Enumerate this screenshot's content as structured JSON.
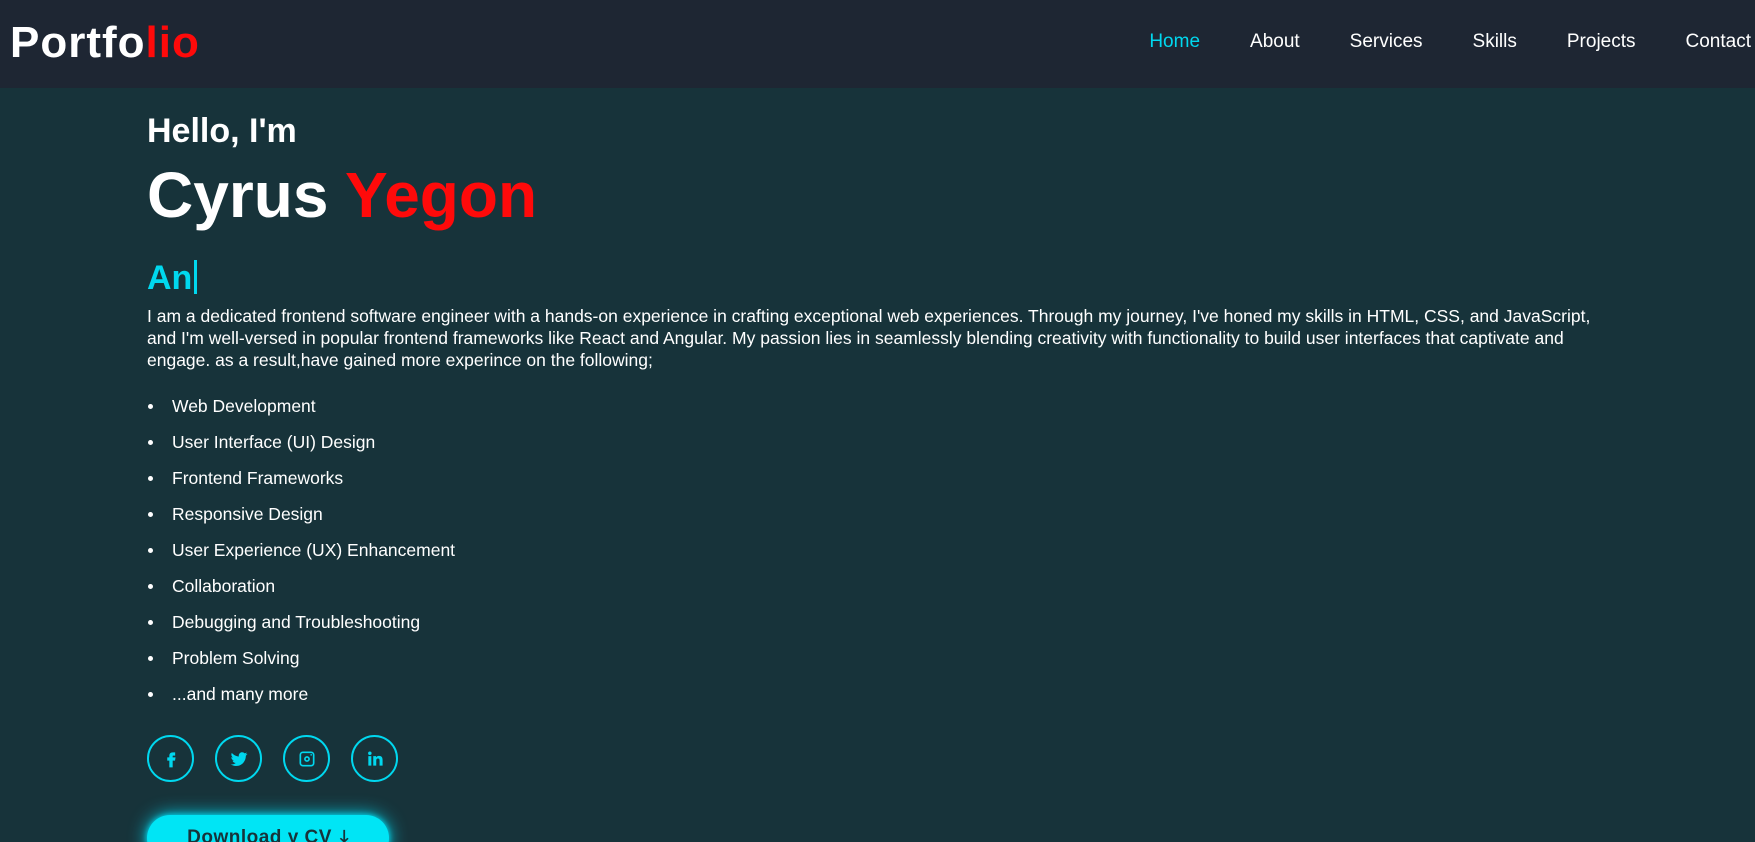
{
  "header": {
    "logo_part1": "Portfo",
    "logo_part2": "lio",
    "nav": [
      {
        "label": "Home",
        "active": true
      },
      {
        "label": "About"
      },
      {
        "label": "Services"
      },
      {
        "label": "Skills"
      },
      {
        "label": "Projects"
      },
      {
        "label": "Contact"
      }
    ]
  },
  "hero": {
    "greeting": "Hello, I'm",
    "first_name": "Cyrus",
    "last_name": "Yegon",
    "typed_text": "An",
    "intro": "I am a dedicated frontend software engineer with a hands-on experience in crafting exceptional web experiences. Through my journey, I've honed my skills in HTML, CSS, and JavaScript, and I'm well-versed in popular frontend frameworks like React and Angular. My passion lies in seamlessly blending creativity with functionality to build user interfaces that captivate and engage. as a result,have gained more experince on the following;",
    "skills": [
      "Web Development",
      "User Interface (UI) Design",
      "Frontend Frameworks",
      "Responsive Design",
      "User Experience (UX) Enhancement",
      "Collaboration",
      "Debugging and Troubleshooting",
      "Problem Solving",
      "...and many more"
    ],
    "socials": [
      "facebook-icon",
      "twitter-icon",
      "instagram-icon",
      "linkedin-icon"
    ],
    "cv_button": "Download y CV",
    "cv_icon": "download-icon"
  },
  "colors": {
    "background": "#17333a",
    "header": "#1e2633",
    "accent": "#00d8ef",
    "highlight": "#ff0a0a"
  }
}
